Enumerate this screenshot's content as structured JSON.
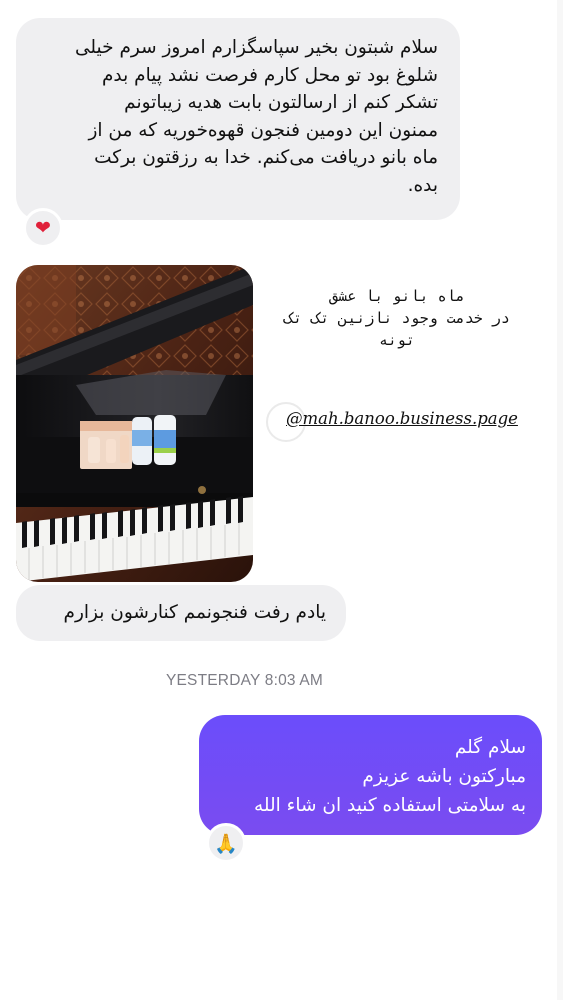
{
  "messages": [
    {
      "lines": [
        "سلام شبتون بخیر سپاسگزارم امروز سرم خیلی",
        "شلوغ بود تو محل کارم فرصت نشد پیام بدم",
        "تشکر کنم از ارسالتون بابت هدیه زیباتونم",
        "ممنون این دومین فنجون قهوه‌خوریه که من از",
        "ماه بانو دریافت می‌کنم. خدا به رزقتون برکت",
        "بده."
      ],
      "reaction": "❤"
    },
    {
      "text": "یادم رفت فنجونمم کنارشون بزارم"
    },
    {
      "lines": [
        "سلام گلم",
        "مبارکتون باشه عزیزم",
        "به سلامتی استفاده کنید ان شاء الله"
      ],
      "reaction": "🙏"
    }
  ],
  "shared_post": {
    "caption_lines": [
      "ماه  بانو  با  عشق",
      "در  خدمت  وجود  نازنین  تک  تک",
      "تونه"
    ],
    "handle": "@mah.banoo.business.page"
  },
  "timestamp": "YESTERDAY 8:03 AM",
  "colors": {
    "incoming_bubble": "#efeff1",
    "outgoing_bubble": "#6b4dfb",
    "timestamp": "#7d7d85"
  }
}
